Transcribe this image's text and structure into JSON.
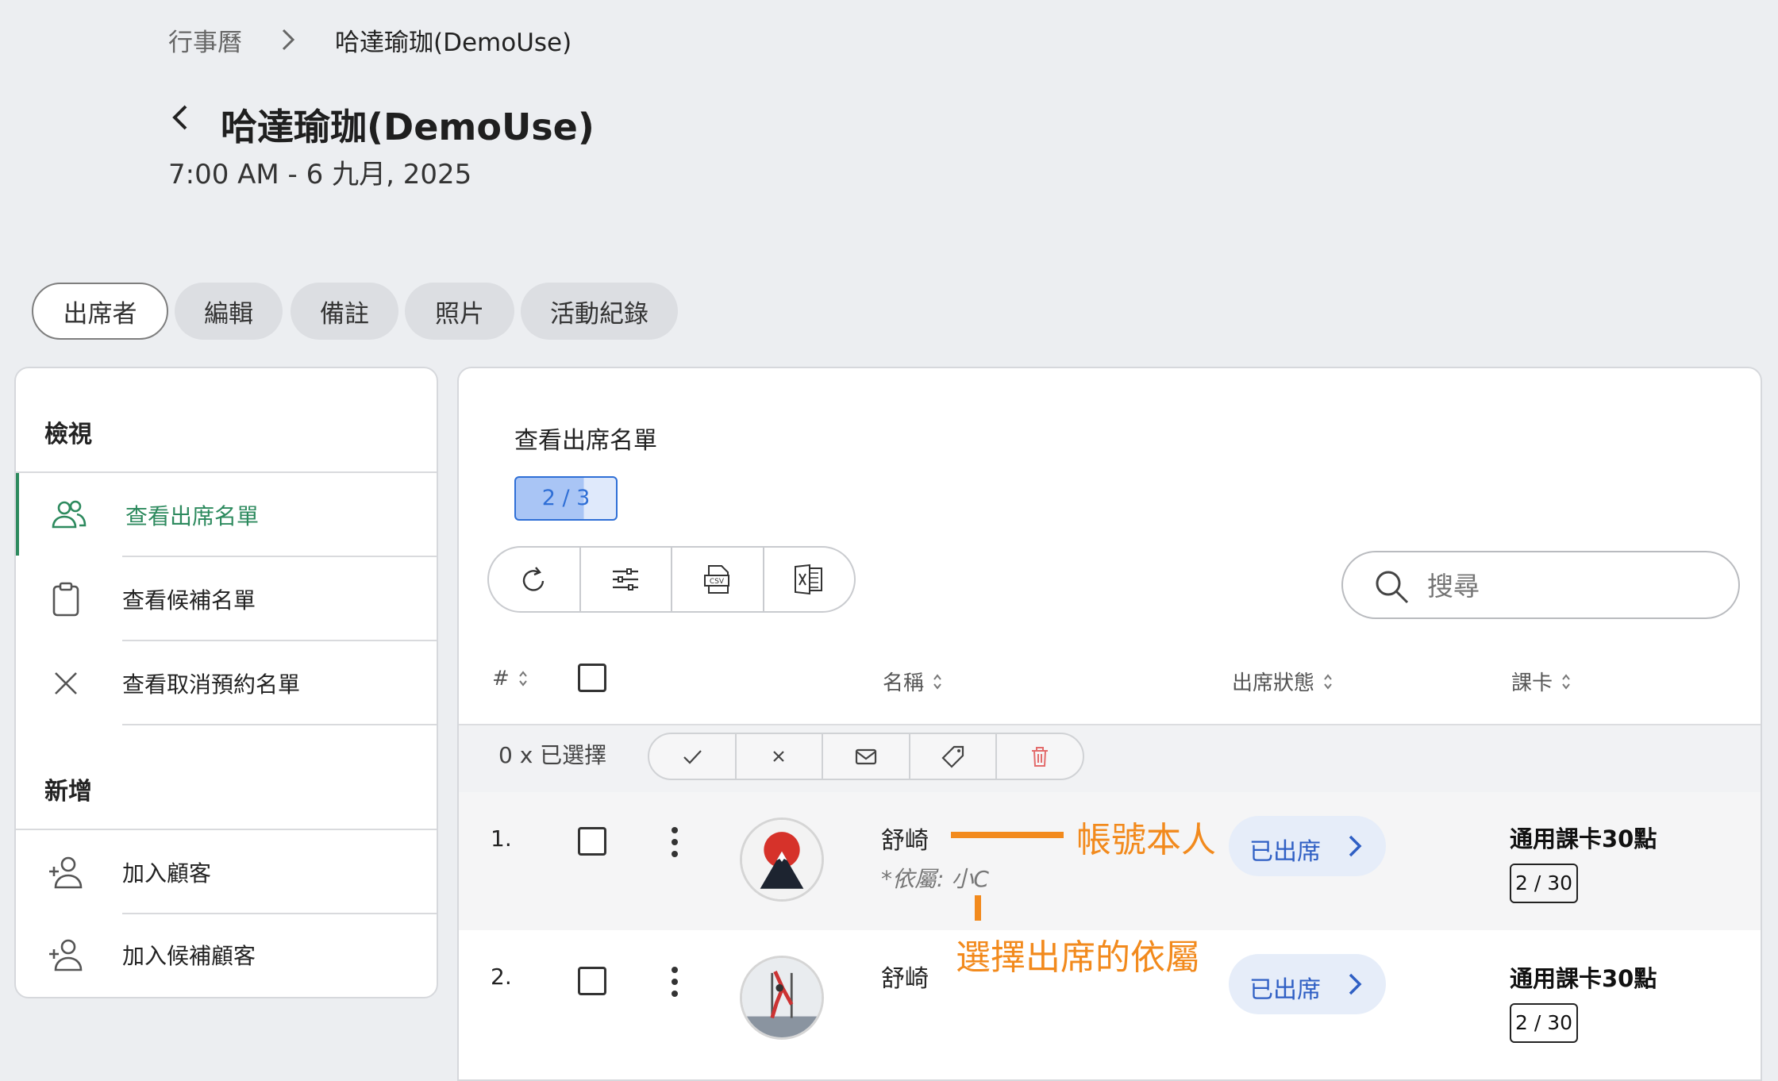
{
  "breadcrumb": {
    "parent": "行事曆",
    "current": "哈達瑜珈(DemoUse)"
  },
  "header": {
    "title": "哈達瑜珈(DemoUse)",
    "subtitle": "7:00 AM - 6 九月, 2025"
  },
  "tabs": [
    {
      "label": "出席者",
      "active": true
    },
    {
      "label": "編輯"
    },
    {
      "label": "備註"
    },
    {
      "label": "照片"
    },
    {
      "label": "活動紀錄"
    }
  ],
  "sidebar": {
    "view_heading": "檢視",
    "view_items": [
      {
        "label": "查看出席名單",
        "icon": "users-icon",
        "active": true
      },
      {
        "label": "查看候補名單",
        "icon": "clipboard-icon"
      },
      {
        "label": "查看取消預約名單",
        "icon": "close-icon"
      }
    ],
    "add_heading": "新增",
    "add_items": [
      {
        "label": "加入顧客",
        "icon": "user-add-icon"
      },
      {
        "label": "加入候補顧客",
        "icon": "user-add-icon"
      }
    ]
  },
  "main": {
    "title": "查看出席名單",
    "capacity": {
      "label": "2 / 3",
      "filled": 2,
      "total": 3
    },
    "toolbar": [
      "refresh-icon",
      "filter-sliders-icon",
      "csv-icon",
      "excel-icon"
    ],
    "search": {
      "placeholder": "搜尋",
      "value": ""
    },
    "columns": {
      "index": "#",
      "name": "名稱",
      "status": "出席狀態",
      "card": "課卡"
    },
    "selection": {
      "label": "0 x 已選擇"
    },
    "bulk_actions": [
      "check-icon",
      "close-icon",
      "mail-icon",
      "tag-icon",
      "trash-icon"
    ],
    "rows": [
      {
        "index": "1.",
        "name": "舒崎",
        "dependent": "*依屬: 小C",
        "status": "已出席",
        "card": "通用課卡30點",
        "usage": "2 / 30"
      },
      {
        "index": "2.",
        "name": "舒崎",
        "dependent": "",
        "status": "已出席",
        "card": "通用課卡30點",
        "usage": "2 / 30"
      }
    ]
  },
  "annotations": {
    "account_owner": "帳號本人",
    "select_dependent": "選擇出席的依屬"
  },
  "colors": {
    "accent_green": "#2d8a5e",
    "status_blue": "#2f5fc4",
    "annotation_orange": "#f28a1d",
    "delete_red": "#e36b6b"
  }
}
